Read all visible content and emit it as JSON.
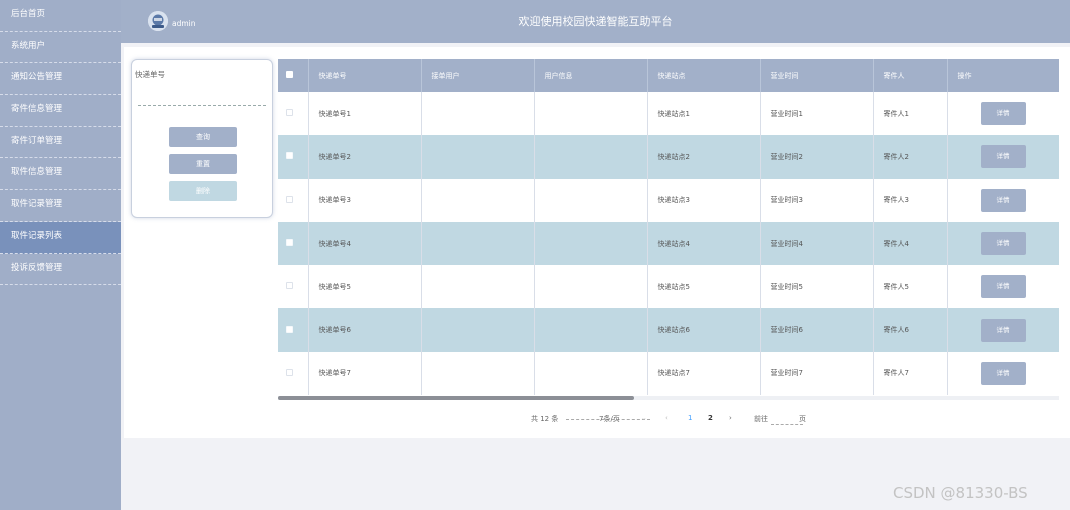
{
  "header": {
    "site_title": "欢迎使用校园快递智能互助平台",
    "user_name": "admin"
  },
  "sidebar": {
    "items": [
      {
        "label": "后台首页",
        "active": false
      },
      {
        "label": "系统用户",
        "active": false
      },
      {
        "label": "通知公告管理",
        "active": false
      },
      {
        "label": "寄件信息管理",
        "active": false
      },
      {
        "label": "寄件订单管理",
        "active": false
      },
      {
        "label": "取件信息管理",
        "active": false
      },
      {
        "label": "取件记录管理",
        "active": false
      },
      {
        "label": "取件记录列表",
        "active": true
      },
      {
        "label": "投诉反馈管理",
        "active": false
      }
    ]
  },
  "search": {
    "field_label": "快递单号",
    "field_value": "",
    "search_label": "查询",
    "reset_label": "重置",
    "delete_label": "删除"
  },
  "table": {
    "columns": [
      "快递单号",
      "接单用户",
      "用户信息",
      "快递站点",
      "营业时间",
      "寄件人",
      "操作"
    ],
    "rows": [
      {
        "no": "快递单号1",
        "user": "",
        "info": "",
        "station": "快递站点1",
        "hours": "营业时间1",
        "sender": "寄件人1"
      },
      {
        "no": "快递单号2",
        "user": "",
        "info": "",
        "station": "快递站点2",
        "hours": "营业时间2",
        "sender": "寄件人2"
      },
      {
        "no": "快递单号3",
        "user": "",
        "info": "",
        "station": "快递站点3",
        "hours": "营业时间3",
        "sender": "寄件人3"
      },
      {
        "no": "快递单号4",
        "user": "",
        "info": "",
        "station": "快递站点4",
        "hours": "营业时间4",
        "sender": "寄件人4"
      },
      {
        "no": "快递单号5",
        "user": "",
        "info": "",
        "station": "快递站点5",
        "hours": "营业时间5",
        "sender": "寄件人5"
      },
      {
        "no": "快递单号6",
        "user": "",
        "info": "",
        "station": "快递站点6",
        "hours": "营业时间6",
        "sender": "寄件人6"
      },
      {
        "no": "快递单号7",
        "user": "",
        "info": "",
        "station": "快递站点7",
        "hours": "营业时间7",
        "sender": "寄件人7"
      }
    ],
    "detail_label": "详情"
  },
  "pagination": {
    "total": "共 12 条",
    "page_size": "7条/页",
    "prev_icon": "chevron-left-icon",
    "next_icon": "chevron-right-icon",
    "pages": [
      "1",
      "2"
    ],
    "current_page": "2",
    "goto_label": "前往",
    "page_label": "页"
  },
  "watermark": "CSDN @81330-BS",
  "colors": {
    "sidebar": "#a0aec8",
    "sidebar_active": "#7991bb",
    "header": "#a2b0c9",
    "stripe": "#c0d8e2",
    "link_blue": "#409eff"
  }
}
